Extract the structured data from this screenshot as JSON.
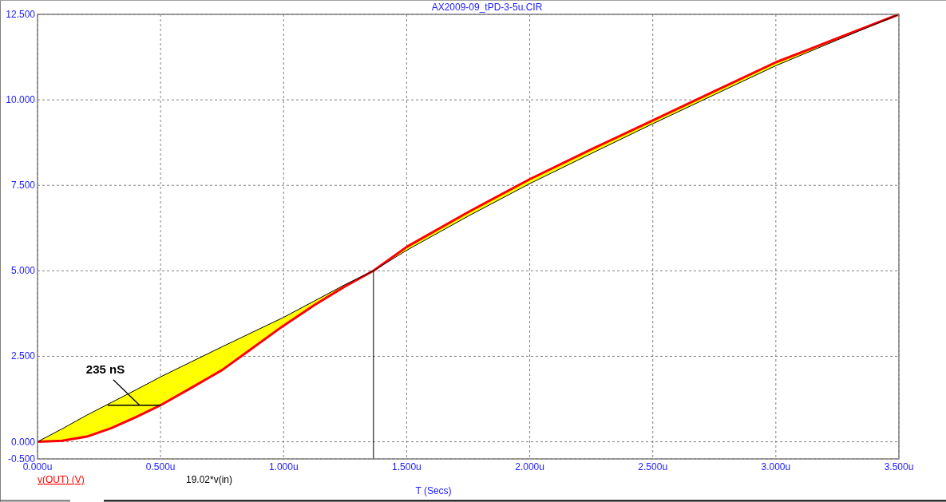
{
  "plot": {
    "chart_data": {
      "type": "line",
      "title": "AX2009-09_tPD-3-5u.CIR",
      "xlabel": "T (Secs)",
      "x": [
        0,
        0.1,
        0.2,
        0.3,
        0.4,
        0.5,
        0.625,
        0.75,
        0.875,
        1.0,
        1.125,
        1.25,
        1.365,
        1.5,
        1.75,
        2.0,
        2.25,
        2.5,
        2.75,
        3.0,
        3.25,
        3.5
      ],
      "series": [
        {
          "name": "v(OUT) (V)",
          "color": "#ff0000",
          "values": [
            0,
            0.03,
            0.15,
            0.4,
            0.72,
            1.07,
            1.58,
            2.1,
            2.75,
            3.4,
            4.0,
            4.55,
            5.0,
            5.7,
            6.72,
            7.68,
            8.55,
            9.4,
            10.25,
            11.1,
            11.8,
            12.5
          ]
        },
        {
          "name": "19.02*v(in)",
          "color": "#000000",
          "values": [
            0,
            0.38,
            0.78,
            1.15,
            1.52,
            1.9,
            2.34,
            2.78,
            3.21,
            3.64,
            4.12,
            4.6,
            5.0,
            5.6,
            6.6,
            7.55,
            8.43,
            9.3,
            10.15,
            11.0,
            11.75,
            12.5
          ]
        }
      ],
      "xlim": [
        0,
        3.5
      ],
      "ylim": [
        -0.5,
        12.5
      ],
      "xticks": [
        {
          "value": 0,
          "label": "0.000u"
        },
        {
          "value": 0.5,
          "label": "0.500u"
        },
        {
          "value": 1,
          "label": "1.000u"
        },
        {
          "value": 1.5,
          "label": "1.500u"
        },
        {
          "value": 2,
          "label": "2.000u"
        },
        {
          "value": 2.5,
          "label": "2.500u"
        },
        {
          "value": 3,
          "label": "3.000u"
        },
        {
          "value": 3.5,
          "label": "3.500u"
        }
      ],
      "yticks": [
        {
          "value": -0.5,
          "label": "-0.500"
        },
        {
          "value": 0,
          "label": "0.000"
        },
        {
          "value": 2.5,
          "label": "2.500"
        },
        {
          "value": 5,
          "label": "5.000"
        },
        {
          "value": 7.5,
          "label": "7.500"
        },
        {
          "value": 10,
          "label": "10.000"
        },
        {
          "value": 12.5,
          "label": "12.500"
        }
      ],
      "grid": true,
      "ref_lines": [
        {
          "axis": "x",
          "value": 1.365
        }
      ],
      "annotations": [
        {
          "text": "235 nS",
          "x": 0.285,
          "y": 1.07
        }
      ]
    }
  }
}
